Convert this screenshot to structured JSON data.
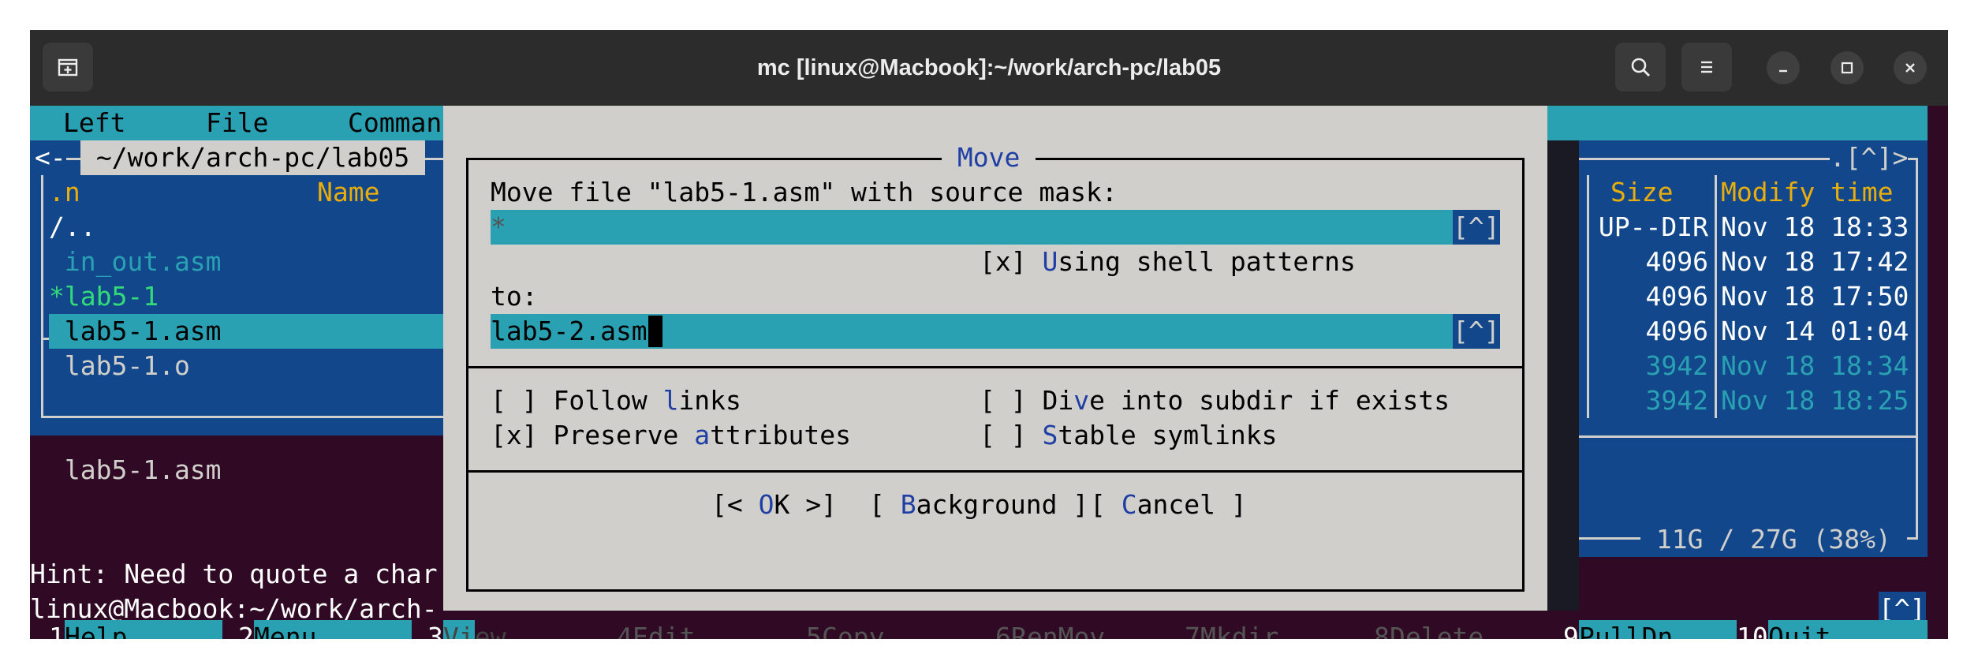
{
  "window": {
    "title": "mc [linux@Macbook]:~/work/arch-pc/lab05",
    "new_tab_icon": "new-tab-icon",
    "search_icon": "search-icon",
    "menu_icon": "hamburger-menu-icon",
    "minimize_icon": "minimize-icon",
    "maximize_icon": "maximize-icon",
    "close_icon": "close-icon"
  },
  "menubar": {
    "items": [
      "Left",
      "File",
      "Comman"
    ]
  },
  "left_panel": {
    "path": " ~/work/arch-pc/lab05 ",
    "frame_prefix": "<-",
    "col_n": ".n",
    "col_name": "Name",
    "files": [
      "/..",
      " in_out.asm",
      "*lab5-1",
      " lab5-1.asm",
      " lab5-1.o"
    ],
    "mini_status": " lab5-1.asm"
  },
  "right_panel": {
    "corner": ".[^]>",
    "col_size": "Size",
    "col_modify": "Modify time",
    "rows": [
      {
        "size": "UP--DIR",
        "time": "Nov 18 18:33"
      },
      {
        "size": "4096",
        "time": "Nov 18 17:42"
      },
      {
        "size": "4096",
        "time": "Nov 18 17:50"
      },
      {
        "size": "4096",
        "time": "Nov 14 01:04"
      },
      {
        "size": "3942",
        "time": "Nov 18 18:34"
      },
      {
        "size": "3942",
        "time": "Nov 18 18:25"
      }
    ],
    "disk_info": " 11G / 27G (38%) "
  },
  "hint": "Hint: Need to quote a char",
  "prompt": "linux@Macbook:~/work/arch-",
  "history_btn": "[^]",
  "dialog": {
    "title": " Move ",
    "source_label": "Move file \"lab5-1.asm\" with source mask:",
    "source_value": "*",
    "history": "[^]",
    "shell_patterns": {
      "box": "[x] ",
      "hot": "U",
      "rest": "sing shell patterns"
    },
    "to_label": "to:",
    "to_value": "lab5-2.asm",
    "follow_links": {
      "box": "[ ] ",
      "pre": "Follow ",
      "hot": "l",
      "post": "inks"
    },
    "preserve_attrs": {
      "box": "[x] ",
      "pre": "Preserve ",
      "hot": "a",
      "post": "ttributes"
    },
    "dive_subdir": {
      "box": "[ ] ",
      "pre": "Di",
      "hot": "v",
      "post": "e into subdir if exists"
    },
    "stable_symlinks": {
      "box": "[ ] ",
      "pre": "",
      "hot": "S",
      "post": "table symlinks"
    },
    "ok": {
      "pre": "[< ",
      "hot": "O",
      "post": "K >]"
    },
    "background": {
      "pre": "[ ",
      "hot": "B",
      "post": "ackground ]"
    },
    "cancel": {
      "pre": "[ ",
      "hot": "C",
      "post": "ancel ]"
    }
  },
  "fkeys": [
    {
      "num": "1",
      "label": "Help"
    },
    {
      "num": "2",
      "label": "Menu"
    },
    {
      "num": "3",
      "label": "View"
    },
    {
      "num": "4",
      "label": "Edit"
    },
    {
      "num": "5",
      "label": "Copy"
    },
    {
      "num": "6",
      "label": "RenMov"
    },
    {
      "num": "7",
      "label": "Mkdir"
    },
    {
      "num": "8",
      "label": "Delete"
    },
    {
      "num": "9",
      "label": "PullDn"
    },
    {
      "num": "10",
      "label": "Quit"
    }
  ],
  "colors": {
    "panel_bg": "#12488b",
    "menubar_bg": "#2aa1b3",
    "dialog_bg": "#d0cfcc",
    "input_bg": "#2aa1b3",
    "terminal_bg": "#300a24",
    "header_yellow": "#e9ad0c",
    "dir_green": "#33da7a",
    "file_cyan": "#2aa1b3"
  }
}
